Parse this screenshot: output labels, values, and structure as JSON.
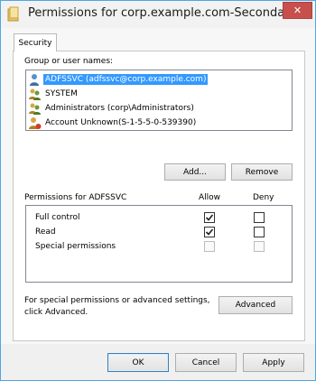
{
  "window": {
    "title": "Permissions for corp.example.com-Secondar...",
    "close_glyph": "✕"
  },
  "tab": {
    "label": "Security"
  },
  "group_section": {
    "label": "Group or user names:",
    "items": [
      {
        "label": "ADFSSVC (adfssvc@corp.example.com)",
        "icon": "user-icon",
        "selected": true
      },
      {
        "label": "SYSTEM",
        "icon": "users-group-icon",
        "selected": false
      },
      {
        "label": "Administrators (corp\\Administrators)",
        "icon": "users-group-icon",
        "selected": false
      },
      {
        "label": "Account Unknown(S-1-5-5-0-539390)",
        "icon": "unknown-user-icon",
        "selected": false
      }
    ],
    "add_button": "Add...",
    "remove_button": "Remove"
  },
  "permissions_section": {
    "label": "Permissions for ADFSSVC",
    "allow_header": "Allow",
    "deny_header": "Deny",
    "rows": [
      {
        "label": "Full control",
        "allow": true,
        "deny": false,
        "enabled": true
      },
      {
        "label": "Read",
        "allow": true,
        "deny": false,
        "enabled": true
      },
      {
        "label": "Special permissions",
        "allow": false,
        "deny": false,
        "enabled": false
      }
    ]
  },
  "advanced_section": {
    "text_line1": "For special permissions or advanced settings,",
    "text_line2": "click Advanced.",
    "advanced_button": "Advanced"
  },
  "footer": {
    "ok_button": "OK",
    "cancel_button": "Cancel",
    "apply_button": "Apply"
  }
}
